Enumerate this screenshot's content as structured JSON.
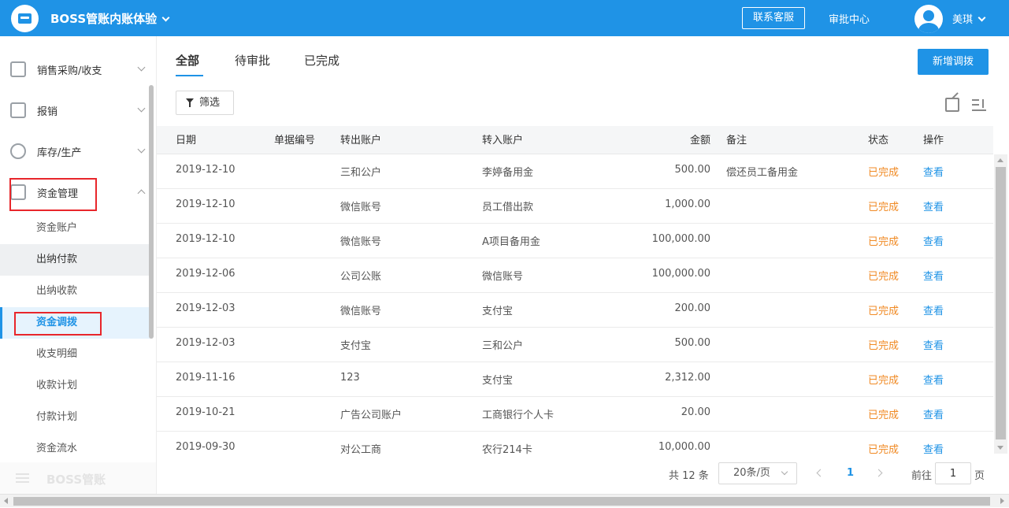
{
  "header": {
    "app_title": "BOSS管账内账体验",
    "contact_label": "联系客服",
    "approval_label": "审批中心",
    "user_name": "美琪",
    "bg_color": "#1f93e6"
  },
  "sidebar": {
    "groups": [
      {
        "label": "销售采购/收支",
        "icon": "sales-icon"
      },
      {
        "label": "报销",
        "icon": "reimburse-icon"
      },
      {
        "label": "库存/生产",
        "icon": "inventory-icon"
      },
      {
        "label": "资金管理",
        "icon": "funds-icon",
        "expanded": true
      }
    ],
    "sub_items": [
      {
        "label": "资金账户"
      },
      {
        "label": "出纳付款"
      },
      {
        "label": "出纳收款"
      },
      {
        "label": "资金调拨",
        "active": true
      },
      {
        "label": "收支明细"
      },
      {
        "label": "收款计划"
      },
      {
        "label": "付款计划"
      },
      {
        "label": "资金流水"
      }
    ],
    "footer_label": "BOSS管账"
  },
  "tabs": [
    {
      "label": "全部",
      "active": true
    },
    {
      "label": "待审批"
    },
    {
      "label": "已完成"
    }
  ],
  "toolbar": {
    "new_button": "新增调拨",
    "filter_button": "筛选"
  },
  "table": {
    "columns": [
      "日期",
      "单据编号",
      "转出账户",
      "转入账户",
      "金额",
      "备注",
      "状态",
      "操作"
    ],
    "rows": [
      {
        "date": "2019-12-10",
        "no": "",
        "from": "三和公户",
        "to": "李婷备用金",
        "amount": "500.00",
        "note": "偿还员工备用金",
        "status": "已完成",
        "action": "查看"
      },
      {
        "date": "2019-12-10",
        "no": "",
        "from": "微信账号",
        "to": "员工借出款",
        "amount": "1,000.00",
        "note": "",
        "status": "已完成",
        "action": "查看"
      },
      {
        "date": "2019-12-10",
        "no": "",
        "from": "微信账号",
        "to": "A项目备用金",
        "amount": "100,000.00",
        "note": "",
        "status": "已完成",
        "action": "查看"
      },
      {
        "date": "2019-12-06",
        "no": "",
        "from": "公司公账",
        "to": "微信账号",
        "amount": "100,000.00",
        "note": "",
        "status": "已完成",
        "action": "查看"
      },
      {
        "date": "2019-12-03",
        "no": "",
        "from": "微信账号",
        "to": "支付宝",
        "amount": "200.00",
        "note": "",
        "status": "已完成",
        "action": "查看"
      },
      {
        "date": "2019-12-03",
        "no": "",
        "from": "支付宝",
        "to": "三和公户",
        "amount": "500.00",
        "note": "",
        "status": "已完成",
        "action": "查看"
      },
      {
        "date": "2019-11-16",
        "no": "",
        "from": "123",
        "to": "支付宝",
        "amount": "2,312.00",
        "note": "",
        "status": "已完成",
        "action": "查看"
      },
      {
        "date": "2019-10-21",
        "no": "",
        "from": "广告公司账户",
        "to": "工商银行个人卡",
        "amount": "20.00",
        "note": "",
        "status": "已完成",
        "action": "查看"
      },
      {
        "date": "2019-09-30",
        "no": "",
        "from": "对公工商",
        "to": "农行214卡",
        "amount": "10,000.00",
        "note": "",
        "status": "已完成",
        "action": "查看"
      }
    ]
  },
  "pagination": {
    "total": "共 12 条",
    "page_size": "20条/页",
    "current_page": "1",
    "goto_label": "前往",
    "goto_value": "1",
    "goto_unit": "页"
  }
}
